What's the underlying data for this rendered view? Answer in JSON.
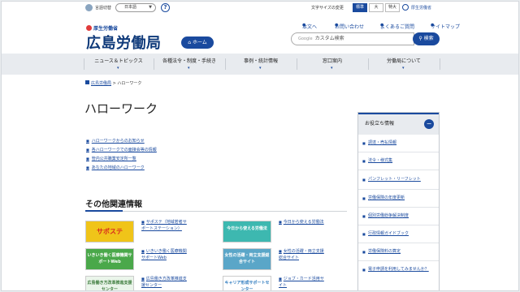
{
  "util": {
    "lang_label": "言語切替",
    "lang_value": "日本語",
    "help": "?",
    "fontsize_label": "文字サイズの変更",
    "fontsizes": [
      "標準",
      "大",
      "特大"
    ],
    "mhlw_link": "厚生労働省"
  },
  "header": {
    "ministry": "厚生労働省",
    "office": "広島労働局",
    "home_button": "ホーム",
    "links": [
      "本文へ",
      "お問い合わせ",
      "よくあるご質問",
      "サイトマップ"
    ],
    "search_placeholder": "カスタム検索",
    "search_brand": "Google",
    "search_button": "検索"
  },
  "nav": [
    "ニュース＆トピックス",
    "各種法令・制度・手続き",
    "事例・統計情報",
    "窓口案内",
    "労働局について"
  ],
  "breadcrumb": {
    "home": "広島労働局",
    "sep": ">",
    "current": "ハローワーク"
  },
  "page_title": "ハローワーク",
  "main_links": [
    "ハローワークからのお知らせ",
    "各ハローワークでの面接会等の情報",
    "管内公共職業安定所一覧",
    "あなたの地域のハローワーク"
  ],
  "related": {
    "title": "その他関連情報",
    "banners": [
      {
        "banner_text": "サポステ",
        "link": "サポステ（地域若者サポートステーション）",
        "color": "#f0c419"
      },
      {
        "banner_text": "いきいき働く医療機関サポートWeb",
        "link": "いきいき働く医療機関サポートWeb",
        "color": "#4aa84a"
      },
      {
        "banner_text": "広島働き方改革推進支援センター",
        "link": "広島働き方改革推進支援センター",
        "color": "#7fc37f"
      },
      {
        "banner_text": "今日から使える労働法",
        "link": "今日から使える労働法",
        "color": "#3db8b0"
      },
      {
        "banner_text": "女性の活躍・両立支援総合サイト",
        "link": "女性の活躍・両立支援総合サイト",
        "color": "#5aa6c8"
      },
      {
        "banner_text": "キャリア形成サポートセンター",
        "link": "ジョブ・カード活用サイト",
        "color": "#2e7bbf"
      }
    ]
  },
  "sidebar": {
    "title": "お役立ち情報",
    "toggle": "−",
    "items": [
      "調達・売払情報",
      "法令・様式集",
      "パンフレット・リーフレット",
      "労働保険の年度更新",
      "個別労働紛争解決制度",
      "行政情報ガイドブック",
      "労働保険料の算定",
      "電子申請を利用してみませんか？"
    ]
  }
}
